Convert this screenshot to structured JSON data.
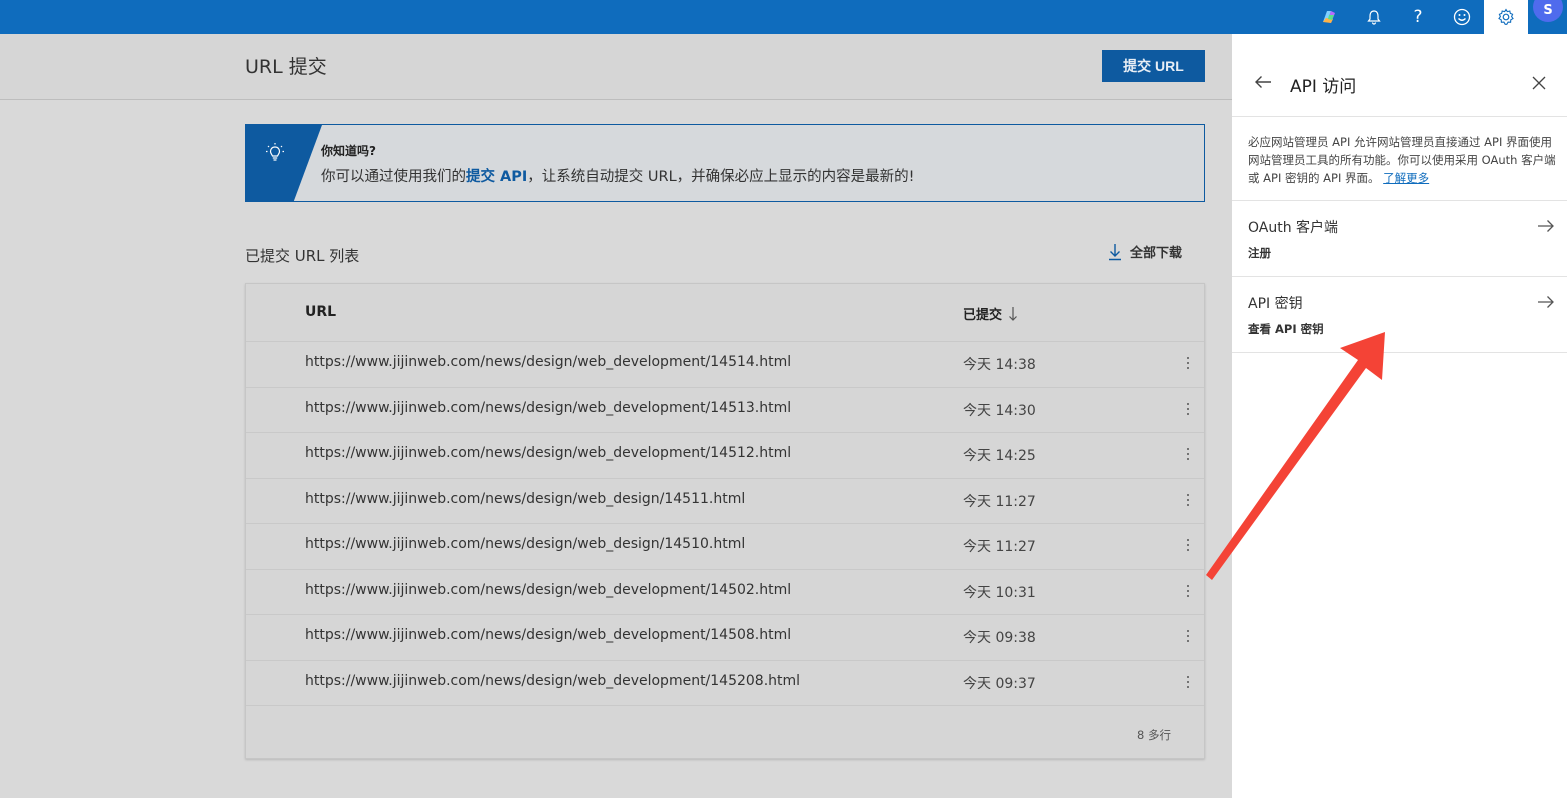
{
  "topbar": {
    "icons": [
      "copilot-icon",
      "bell-icon",
      "help-icon",
      "smiley-icon",
      "gear-icon"
    ],
    "help_glyph": "?",
    "avatar_initial": "S",
    "colors": {
      "bar": "#0f6cbd",
      "avatar": "#4f6bed"
    }
  },
  "header": {
    "title": "URL 提交",
    "submit_button": "提交 URL"
  },
  "tip": {
    "title": "你知道吗?",
    "text_before": "你可以通过使用我们的",
    "link": "提交 API",
    "text_after": "，让系统自动提交 URL，并确保必应上显示的内容是最新的!"
  },
  "list": {
    "title": "已提交 URL 列表",
    "download": "全部下载",
    "columns": {
      "url": "URL",
      "submitted": "已提交"
    },
    "rows": [
      {
        "url": "https://www.jijinweb.com/news/design/web_development/14514.html",
        "date": "今天 14:38"
      },
      {
        "url": "https://www.jijinweb.com/news/design/web_development/14513.html",
        "date": "今天 14:30"
      },
      {
        "url": "https://www.jijinweb.com/news/design/web_development/14512.html",
        "date": "今天 14:25"
      },
      {
        "url": "https://www.jijinweb.com/news/design/web_design/14511.html",
        "date": "今天 11:27"
      },
      {
        "url": "https://www.jijinweb.com/news/design/web_design/14510.html",
        "date": "今天 11:27"
      },
      {
        "url": "https://www.jijinweb.com/news/design/web_development/14502.html",
        "date": "今天 10:31"
      },
      {
        "url": "https://www.jijinweb.com/news/design/web_development/14508.html",
        "date": "今天 09:38"
      },
      {
        "url": "https://www.jijinweb.com/news/design/web_development/145208.html",
        "date": "今天 09:37"
      }
    ],
    "row_count": "8 多行"
  },
  "panel": {
    "title": "API 访问",
    "description": "必应网站管理员 API 允许网站管理员直接通过 API 界面使用网站管理员工具的所有功能。你可以使用采用 OAuth 客户端或 API 密钥的 API 界面。",
    "learn_more": "了解更多",
    "items": [
      {
        "name": "OAuth 客户端",
        "sub": "注册"
      },
      {
        "name": "API 密钥",
        "sub": "查看 API 密钥"
      }
    ]
  },
  "annotation": {
    "type": "red-arrow",
    "color": "#f44336"
  }
}
